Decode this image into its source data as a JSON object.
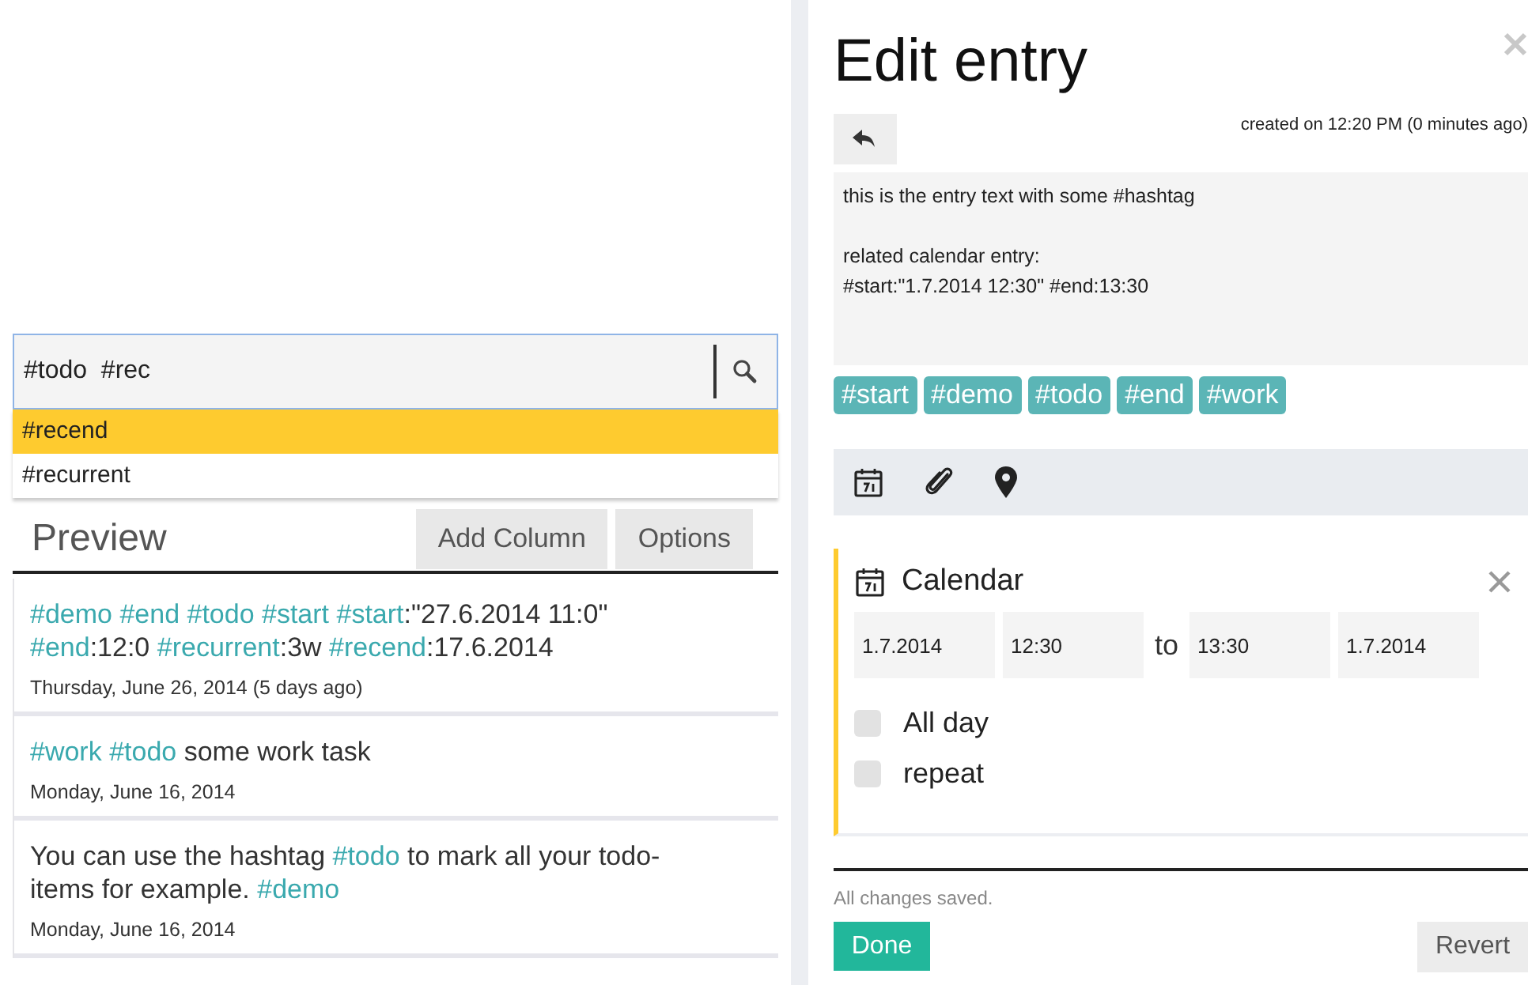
{
  "search": {
    "value": "#todo  #rec"
  },
  "suggestions": [
    {
      "label": "#recend",
      "selected": true
    },
    {
      "label": "#recurrent",
      "selected": false
    }
  ],
  "preview": {
    "title": "Preview",
    "buttons": [
      "Add Column",
      "Options"
    ]
  },
  "entries": [
    {
      "segments": [
        {
          "kind": "tag",
          "text": "#demo #end #todo #start #start"
        },
        {
          "kind": "plain",
          "text": ":\"27.6.2014 11:0\" "
        },
        {
          "kind": "tag",
          "text": "#end"
        },
        {
          "kind": "plain",
          "text": ":12:0 "
        },
        {
          "kind": "tag",
          "text": "#recurrent"
        },
        {
          "kind": "plain",
          "text": ":3w "
        },
        {
          "kind": "tag",
          "text": "#recend"
        },
        {
          "kind": "plain",
          "text": ":17.6.2014"
        }
      ],
      "date": "Thursday, June 26, 2014 (5 days ago)"
    },
    {
      "segments": [
        {
          "kind": "tag",
          "text": "#work #todo"
        },
        {
          "kind": "plain",
          "text": " some work task"
        }
      ],
      "date": "Monday, June 16, 2014"
    },
    {
      "segments": [
        {
          "kind": "plain",
          "text": "You can use the hashtag "
        },
        {
          "kind": "tag",
          "text": "#todo"
        },
        {
          "kind": "plain",
          "text": " to mark all your todo-items for example. "
        },
        {
          "kind": "tag",
          "text": "#demo"
        }
      ],
      "date": "Monday, June 16, 2014"
    }
  ],
  "editor": {
    "title": "Edit entry",
    "created": "created on 12:20 PM (0 minutes ago)",
    "text": "this is the entry text with some #hashtag\n\nrelated calendar entry:\n#start:\"1.7.2014 12:30\" #end:13:30",
    "tags": [
      "#start",
      "#demo",
      "#todo",
      "#end",
      "#work"
    ],
    "calendar": {
      "title": "Calendar",
      "from_date": "1.7.2014",
      "from_time": "12:30",
      "separator": "to",
      "to_time": "13:30",
      "to_date": "1.7.2014",
      "options": [
        {
          "label": "All day",
          "checked": false
        },
        {
          "label": "repeat",
          "checked": false
        }
      ]
    },
    "status": "All changes saved.",
    "done": "Done",
    "revert": "Revert"
  }
}
